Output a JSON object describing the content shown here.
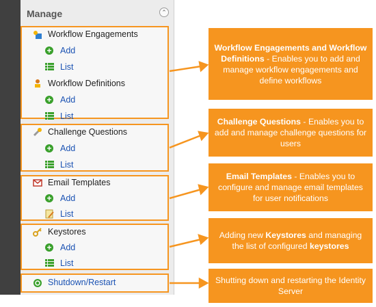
{
  "manage": {
    "title": "Manage",
    "groups": [
      {
        "title": "Workflow Engagements",
        "add": "Add",
        "list": "List"
      },
      {
        "title": "Workflow Definitions",
        "add": "Add",
        "list": "List"
      },
      {
        "title": "Challenge Questions",
        "add": "Add",
        "list": "List"
      },
      {
        "title": "Email Templates",
        "add": "Add",
        "list": "List"
      },
      {
        "title": "Keystores",
        "add": "Add",
        "list": "List"
      }
    ],
    "shutdown": "Shutdown/Restart"
  },
  "callouts": [
    {
      "bold": "Workflow Engagements and Workflow Definitions",
      "rest": " - Enables you to add and manage workflow engagements and define workflows"
    },
    {
      "bold": "Challenge Questions",
      "rest": " - Enables you to add and manage challenge questions for users"
    },
    {
      "bold": "Email Templates",
      "rest": " - Enables you to configure and manage email templates for user notifications"
    },
    {
      "pre": "Adding new ",
      "bold": "Keystores",
      "rest": " and managing the list of configured ",
      "bold2": "keystores"
    },
    {
      "text": "Shutting down and restarting the Identity Server"
    }
  ],
  "colors": {
    "accent": "#f6951f",
    "link": "#1a52b3",
    "add": "#3aa02c"
  }
}
